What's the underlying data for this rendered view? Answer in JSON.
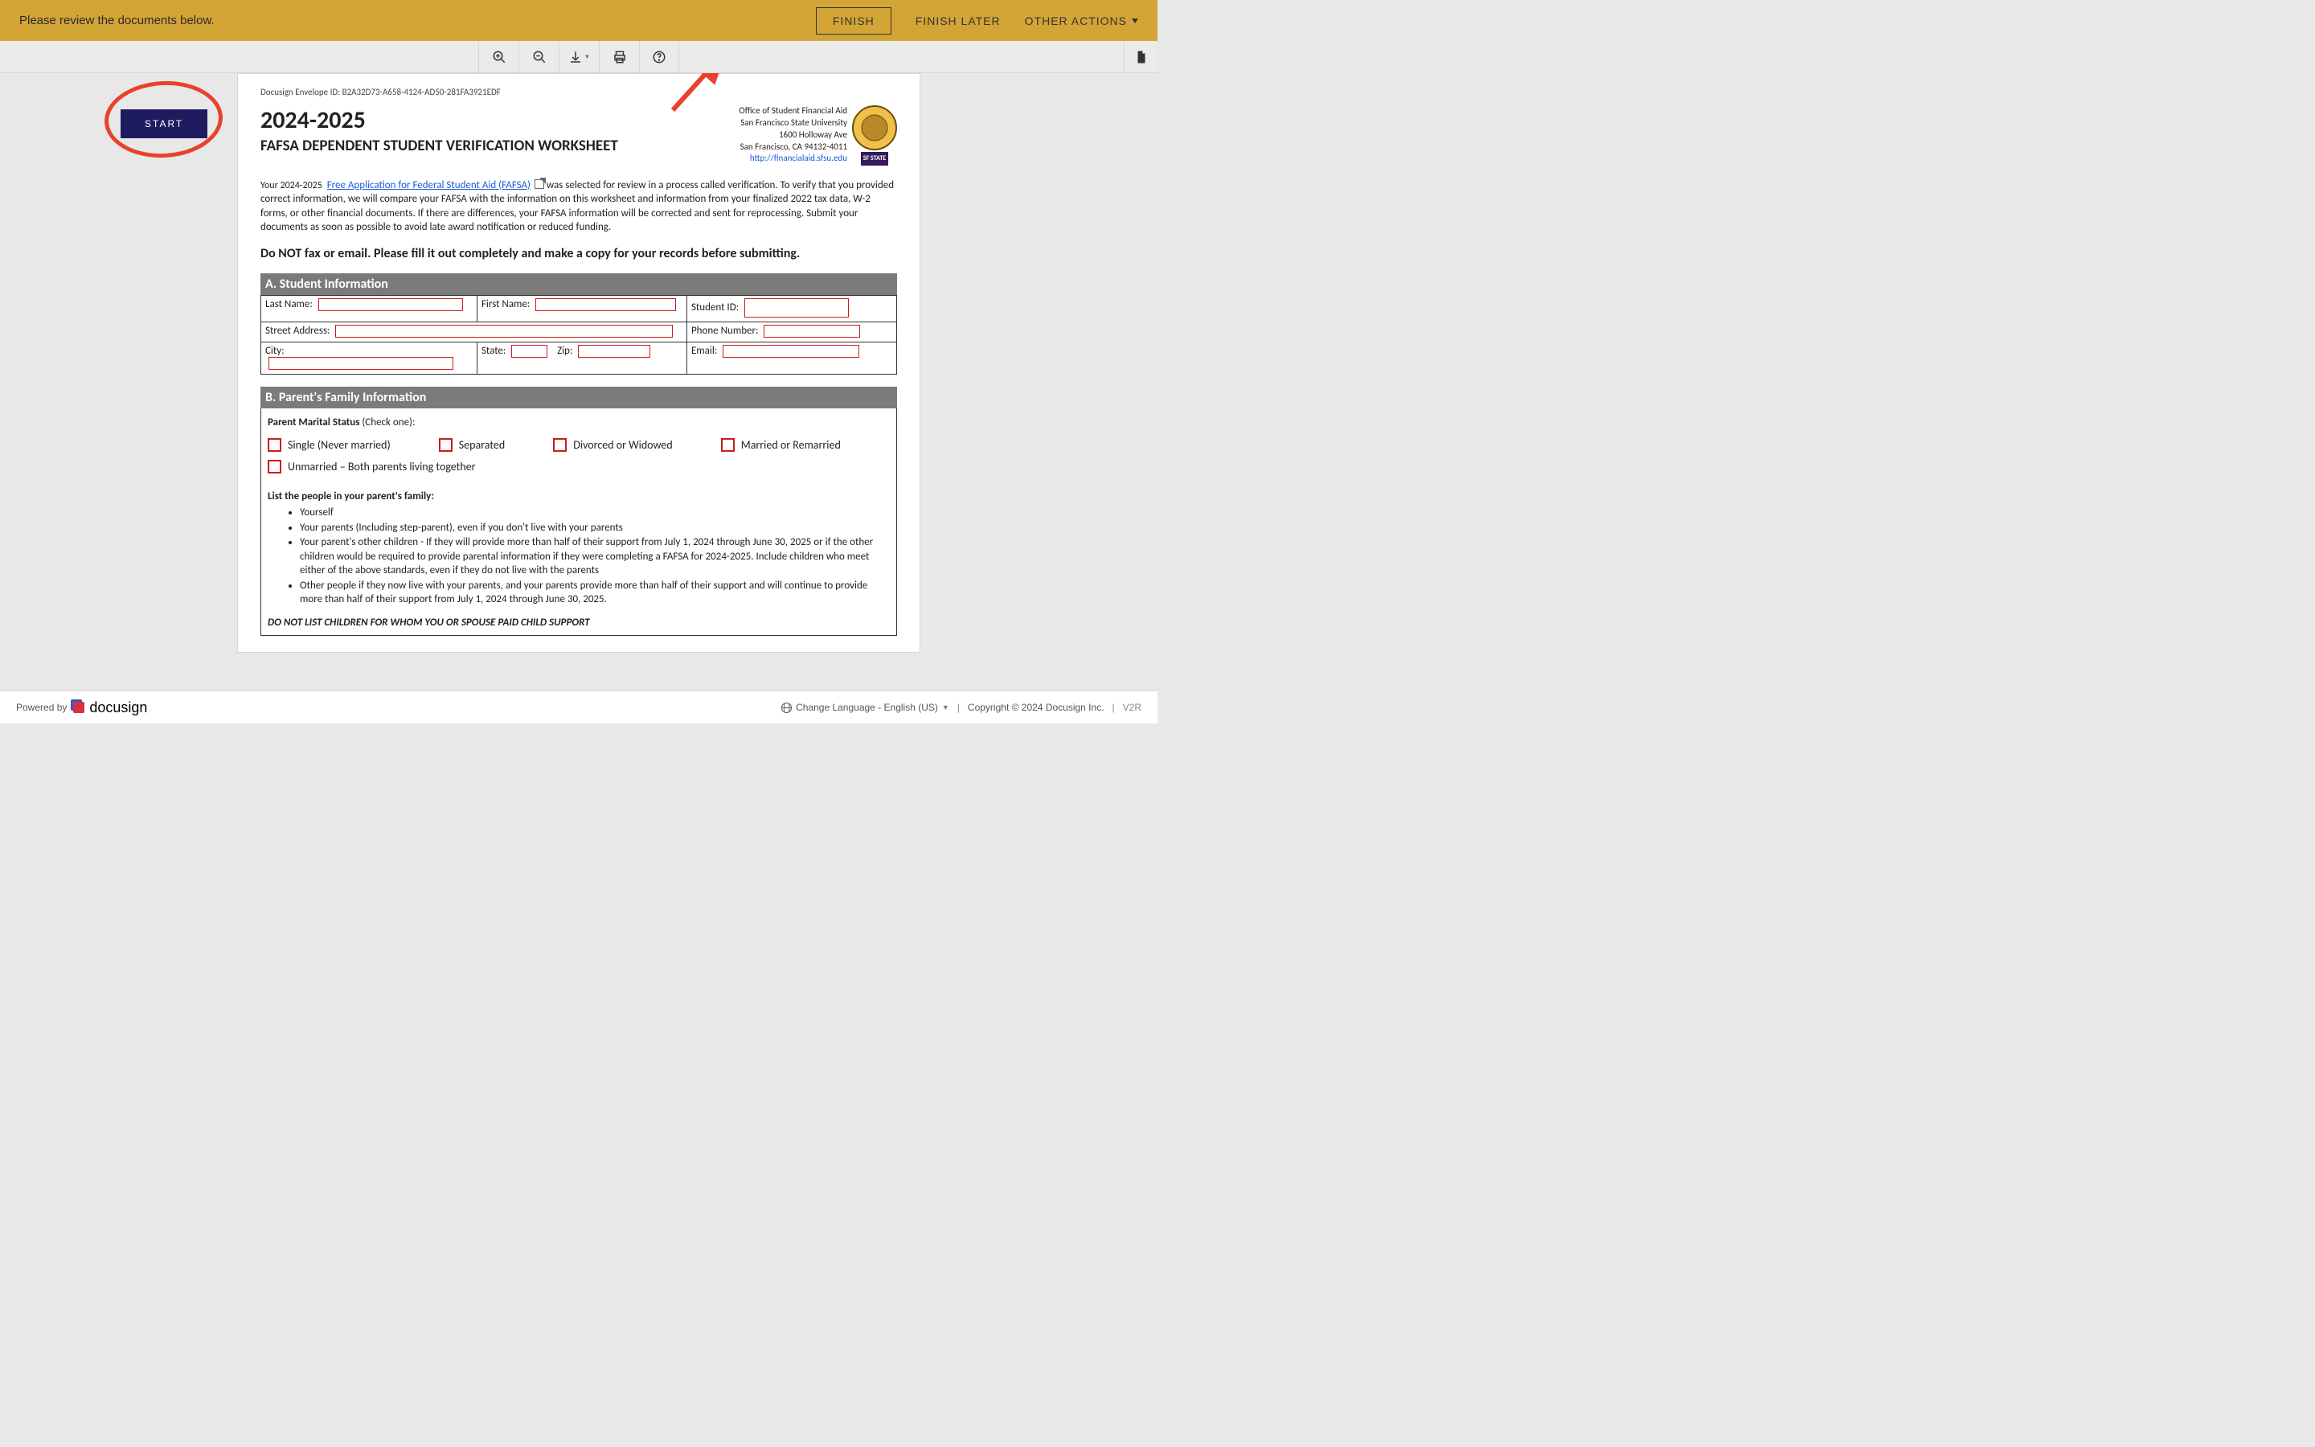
{
  "topbar": {
    "message": "Please review the documents below.",
    "finish": "FINISH",
    "finish_later": "FINISH LATER",
    "other_actions": "OTHER ACTIONS"
  },
  "start_label": "START",
  "envelope_id_line": "Docusign Envelope ID: B2A32D73-A658-4124-AD50-281FA3921EDF",
  "doc": {
    "year": "2024-2025",
    "title": "FAFSA DEPENDENT STUDENT VERIFICATION WORKSHEET",
    "office_lines": [
      "Office of Student Financial Aid",
      "San Francisco State University",
      "1600 Holloway Ave",
      "San Francisco, CA 94132-4011"
    ],
    "office_url": "http://financialaid.sfsu.edu",
    "sf_badge": "SF STATE",
    "intro_lead": "Your 2024-2025",
    "fafsa_link": "Free Application for Federal Student Aid (FAFSA)",
    "intro_rest": " was selected for review in a process called verification. To verify that you provided correct information, we will compare your FAFSA with the information on this worksheet and information from your finalized 2022 tax data, W-2 forms, or other financial documents. If there are differences, your FAFSA information will be corrected and sent for reprocessing. Submit your documents as soon as possible to avoid late award notification or reduced funding.",
    "no_fax": "Do NOT fax or email. Please fill it out completely and make a copy for your records before submitting.",
    "sectionA": "A. Student Information",
    "fields": {
      "last_name": "Last Name:",
      "first_name": "First Name:",
      "student_id": "Student ID:",
      "street": "Street Address:",
      "phone": "Phone Number:",
      "city": "City:",
      "state": "State:",
      "zip": "Zip:",
      "email": "Email:"
    },
    "sectionB": "B. Parent's Family Information",
    "parent_marital_label": "Parent Marital Status",
    "parent_marital_hint": " (Check one):",
    "options": {
      "single": "Single (Never married)",
      "separated": "Separated",
      "divorced": "Divorced or Widowed",
      "married": "Married or Remarried",
      "unmarried_both": "Unmarried – Both parents living together"
    },
    "list_title": "List the people in your parent's family:",
    "family_list": [
      "Yourself",
      "Your parents (Including step-parent), even if you don't live with your parents",
      "Your parent's other children - If they will provide more than half of their support from July 1, 2024 through June 30, 2025 or if the other children would be required to provide parental information if they were completing a FAFSA for 2024-2025. Include children who meet either of the above standards, even if they do not live with the parents",
      "Other people if they now live with your parents, and your parents provide more than half of their support and will continue to provide more than half of their support from July 1, 2024 through June 30, 2025."
    ],
    "no_list_children": "DO NOT LIST CHILDREN FOR WHOM YOU OR SPOUSE PAID CHILD SUPPORT"
  },
  "footer": {
    "powered_by": "Powered by",
    "brand": "docusign",
    "change_lang": "Change Language - English (US)",
    "copyright": "Copyright © 2024 Docusign Inc.",
    "v2r": "V2R"
  }
}
